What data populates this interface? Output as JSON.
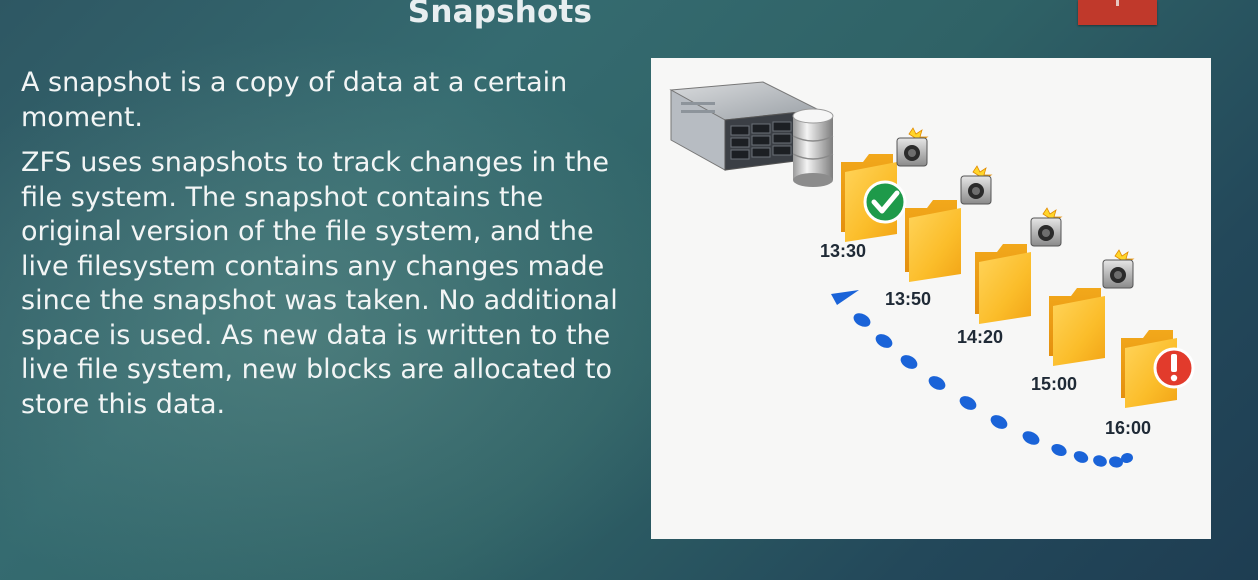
{
  "slide": {
    "title": "Snapshots",
    "paragraphs": [
      "A snapshot is a copy of data at a certain moment.",
      "ZFS uses snapshots to track changes in the file system. The snapshot contains the original version of the file system, and the live filesystem contains any changes made since the snapshot was taken. No additional space is used. As new data is written to the live file system, new blocks are allocated to store this data."
    ],
    "accent_color": "#c0392b"
  },
  "figure": {
    "timestamps": [
      "13:30",
      "13:50",
      "14:20",
      "15:00",
      "16:00"
    ],
    "icons": [
      "server-icon",
      "database-icon",
      "folder-icon",
      "camera-icon",
      "checkmark-icon",
      "alert-icon"
    ],
    "folder_color": "#f6b31c",
    "check_color": "#1e9a4a",
    "alert_color": "#e23b2c",
    "dash_color": "#1a63d8"
  }
}
